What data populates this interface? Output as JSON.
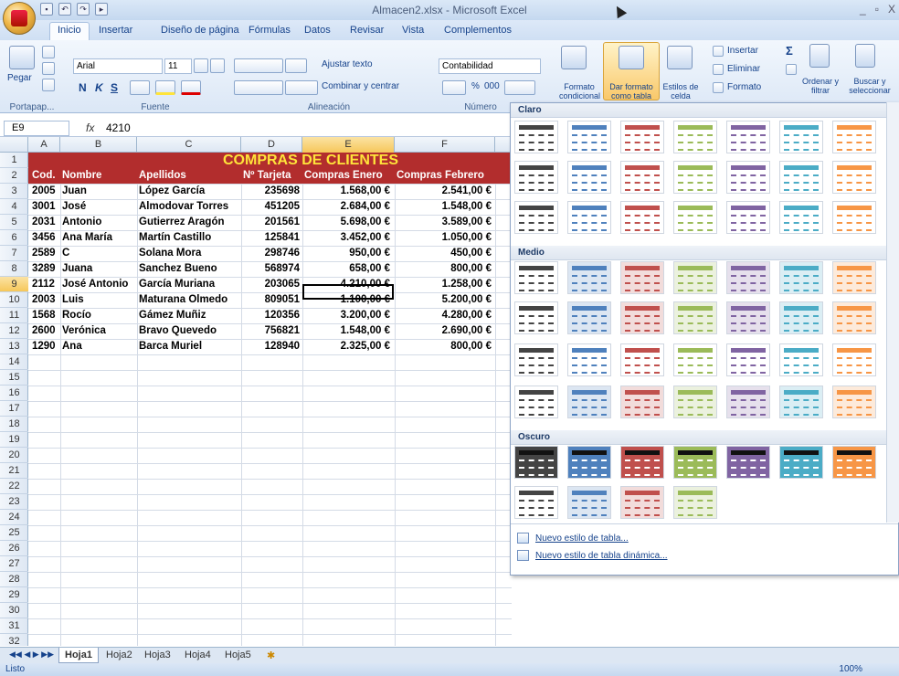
{
  "window": {
    "title": "Almacen2.xlsx - Microsoft Excel",
    "controls": [
      "_",
      "▫",
      "X"
    ]
  },
  "tabs": [
    "Inicio",
    "Insertar",
    "Diseño de página",
    "Fórmulas",
    "Datos",
    "Revisar",
    "Vista",
    "Complementos"
  ],
  "ribbon": {
    "paste_label": "Pegar",
    "font_name": "Arial",
    "font_size": "11",
    "bold": "N",
    "italic": "K",
    "underline": "S",
    "wrap_text": "Ajustar texto",
    "merge_center": "Combinar y centrar",
    "number_format": "Contabilidad",
    "percent": "%",
    "thousands": "000",
    "conditional_format": "Formato condicional",
    "format_as_table": "Dar formato como tabla",
    "cell_styles": "Estilos de celda",
    "insert": "Insertar",
    "delete": "Eliminar",
    "format": "Formato",
    "sort_filter": "Ordenar y filtrar",
    "find_select": "Buscar y seleccionar",
    "groups": {
      "clipboard": "Portapap...",
      "font": "Fuente",
      "alignment": "Alineación",
      "number": "Número"
    }
  },
  "formula_bar": {
    "name_box": "E9",
    "fx": "fx",
    "value": "4210"
  },
  "columns": [
    "A",
    "B",
    "C",
    "D",
    "E",
    "F"
  ],
  "selected_column": "E",
  "selected_row": 9,
  "sheet": {
    "title": "COMPRAS DE CLIENTES",
    "headers": [
      "Cod.",
      "Nombre",
      "Apellidos",
      "Nº Tarjeta",
      "Compras Enero",
      "Compras Febrero"
    ],
    "rows": [
      [
        "2005",
        "Juan",
        "López García",
        "235698",
        "1.568,00 €",
        "2.541,00 €"
      ],
      [
        "3001",
        "José",
        "Almodovar Torres",
        "451205",
        "2.684,00 €",
        "1.548,00 €"
      ],
      [
        "2031",
        "Antonio",
        "Gutierrez Aragón",
        "201561",
        "5.698,00 €",
        "3.589,00 €"
      ],
      [
        "3456",
        "Ana María",
        "Martín Castillo",
        "125841",
        "3.452,00 €",
        "1.050,00 €"
      ],
      [
        "2589",
        "C",
        "Solana Mora",
        "298746",
        "950,00 €",
        "450,00 €"
      ],
      [
        "3289",
        "Juana",
        "Sanchez Bueno",
        "568974",
        "658,00 €",
        "800,00 €"
      ],
      [
        "2112",
        "José Antonio",
        "García Muriana",
        "203065",
        "4.210,00 €",
        "1.258,00 €"
      ],
      [
        "2003",
        "Luis",
        "Maturana Olmedo",
        "809051",
        "1.100,00 €",
        "5.200,00 €"
      ],
      [
        "1568",
        "Rocío",
        "Gámez Muñiz",
        "120356",
        "3.200,00 €",
        "4.280,00 €"
      ],
      [
        "2600",
        "Verónica",
        "Bravo Quevedo",
        "756821",
        "1.548,00 €",
        "2.690,00 €"
      ],
      [
        "1290",
        "Ana",
        "Barca Muriel",
        "128940",
        "2.325,00 €",
        "800,00 €"
      ]
    ]
  },
  "gallery": {
    "sections": [
      "Claro",
      "Medio",
      "Oscuro"
    ],
    "new_table_style": "Nuevo estilo de tabla...",
    "new_pivot_style": "Nuevo estilo de tabla dinámica..."
  },
  "sheet_tabs": [
    "Hoja1",
    "Hoja2",
    "Hoja3",
    "Hoja4",
    "Hoja5"
  ],
  "active_sheet": "Hoja1",
  "status": {
    "mode": "Listo",
    "zoom": "100%"
  },
  "colors": {
    "title_bg": "#b22d2d",
    "title_text": "#ffe43a",
    "accent": "#15428b"
  }
}
